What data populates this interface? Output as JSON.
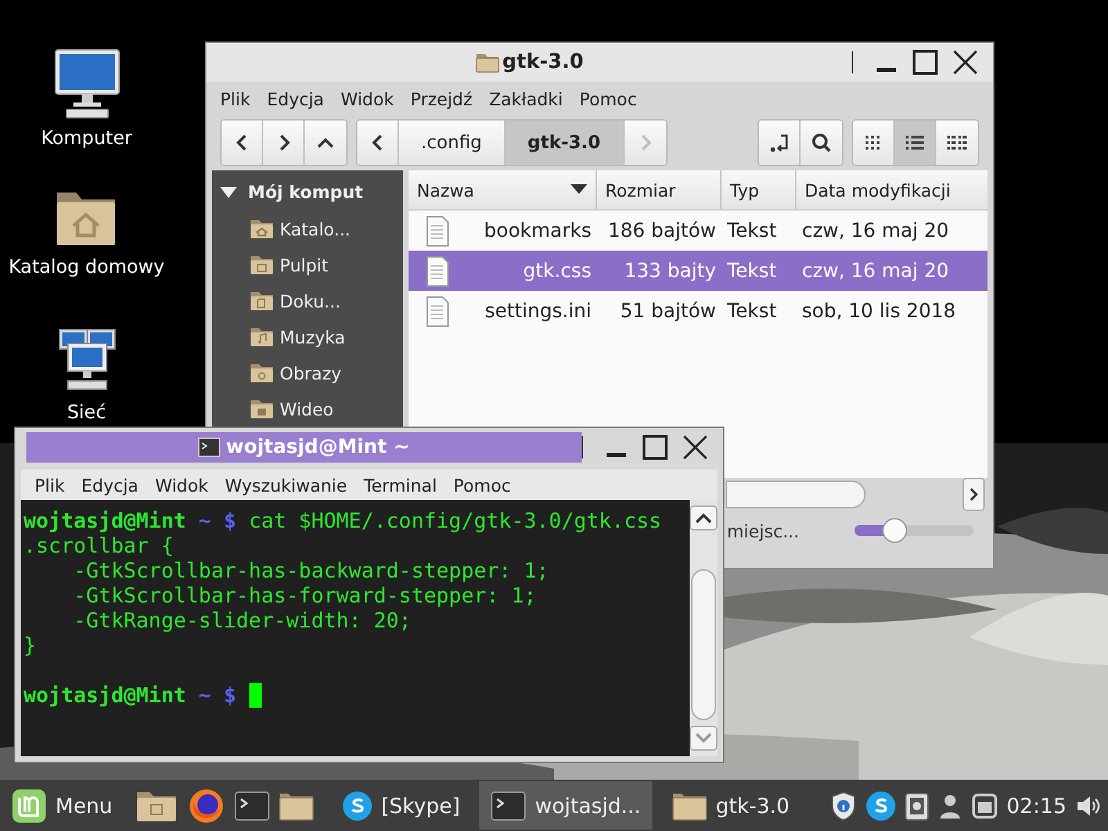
{
  "desktop": {
    "icons": [
      {
        "kind": "computer",
        "label": "Komputer"
      },
      {
        "kind": "home",
        "label": "Katalog domowy"
      },
      {
        "kind": "network",
        "label": "Sieć"
      }
    ]
  },
  "file_manager": {
    "title": "gtk-3.0",
    "menu": [
      "Plik",
      "Edycja",
      "Widok",
      "Przejdź",
      "Zakładki",
      "Pomoc"
    ],
    "path": [
      {
        "label": ".config",
        "selected": false
      },
      {
        "label": "gtk-3.0",
        "selected": true
      }
    ],
    "views": [
      {
        "kind": "icons",
        "selected": false
      },
      {
        "kind": "list",
        "selected": true
      },
      {
        "kind": "compact",
        "selected": false
      }
    ],
    "sidebar": {
      "title": "Mój komput",
      "expanded": true,
      "items": [
        {
          "kind": "home",
          "label": "Katalo..."
        },
        {
          "kind": "desktop",
          "label": "Pulpit"
        },
        {
          "kind": "documents",
          "label": "Doku..."
        },
        {
          "kind": "music",
          "label": "Muzyka"
        },
        {
          "kind": "pictures",
          "label": "Obrazy"
        },
        {
          "kind": "videos",
          "label": "Wideo"
        }
      ]
    },
    "columns": [
      "Nazwa",
      "Rozmiar",
      "Typ",
      "Data modyfikacji"
    ],
    "rows": [
      {
        "name": "bookmarks",
        "size": "186 bajtów",
        "type": "Tekst",
        "date": "czw, 16 maj 20",
        "selected": false
      },
      {
        "name": "gtk.css",
        "size": "133 bajty",
        "type": "Tekst",
        "date": "czw, 16 maj 20",
        "selected": true
      },
      {
        "name": "settings.ini",
        "size": "51 bajtów",
        "type": "Tekst",
        "date": "sob, 10 lis 2018",
        "selected": false
      }
    ],
    "status": "miejsc...",
    "zoom": {
      "level": 0.3
    }
  },
  "terminal": {
    "title": "wojtasjd@Mint ~",
    "menu": [
      "Plik",
      "Edycja",
      "Widok",
      "Wyszukiwanie",
      "Terminal",
      "Pomoc"
    ],
    "lines": [
      {
        "segments": [
          {
            "kind": "user",
            "text": "wojtasjd@Mint"
          },
          {
            "kind": "prompt",
            "text": " ~ $ "
          },
          {
            "kind": "output",
            "text": "cat $HOME/.config/gtk-3.0/gtk.css"
          }
        ]
      },
      {
        "segments": [
          {
            "kind": "output",
            "text": ".scrollbar {"
          }
        ]
      },
      {
        "segments": [
          {
            "kind": "output",
            "text": "    -GtkScrollbar-has-backward-stepper: 1;"
          }
        ]
      },
      {
        "segments": [
          {
            "kind": "output",
            "text": "    -GtkScrollbar-has-forward-stepper: 1;"
          }
        ]
      },
      {
        "segments": [
          {
            "kind": "output",
            "text": "    -GtkRange-slider-width: 20;"
          }
        ]
      },
      {
        "segments": [
          {
            "kind": "output",
            "text": "}"
          }
        ]
      },
      {
        "segments": [
          {
            "kind": "user",
            "text": "wojtasjd@Mint"
          },
          {
            "kind": "prompt",
            "text": " ~ $ "
          }
        ]
      }
    ],
    "cursor": true
  },
  "taskbar": {
    "menu": "Menu",
    "launchers": [
      {
        "kind": "files"
      },
      {
        "kind": "firefox"
      },
      {
        "kind": "terminal"
      },
      {
        "kind": "folder"
      }
    ],
    "tasks": [
      {
        "kind": "skype",
        "label": "[Skype]",
        "selected": false
      },
      {
        "kind": "terminal",
        "label": "wojtasjd...",
        "selected": true
      },
      {
        "kind": "folder",
        "label": "gtk-3.0",
        "selected": false
      }
    ],
    "tray": [
      {
        "kind": "shield"
      },
      {
        "kind": "skype"
      },
      {
        "kind": "clipboard"
      },
      {
        "kind": "user"
      },
      {
        "kind": "window"
      },
      {
        "kind": "clock",
        "text": "02:15"
      },
      {
        "kind": "volume"
      }
    ]
  }
}
